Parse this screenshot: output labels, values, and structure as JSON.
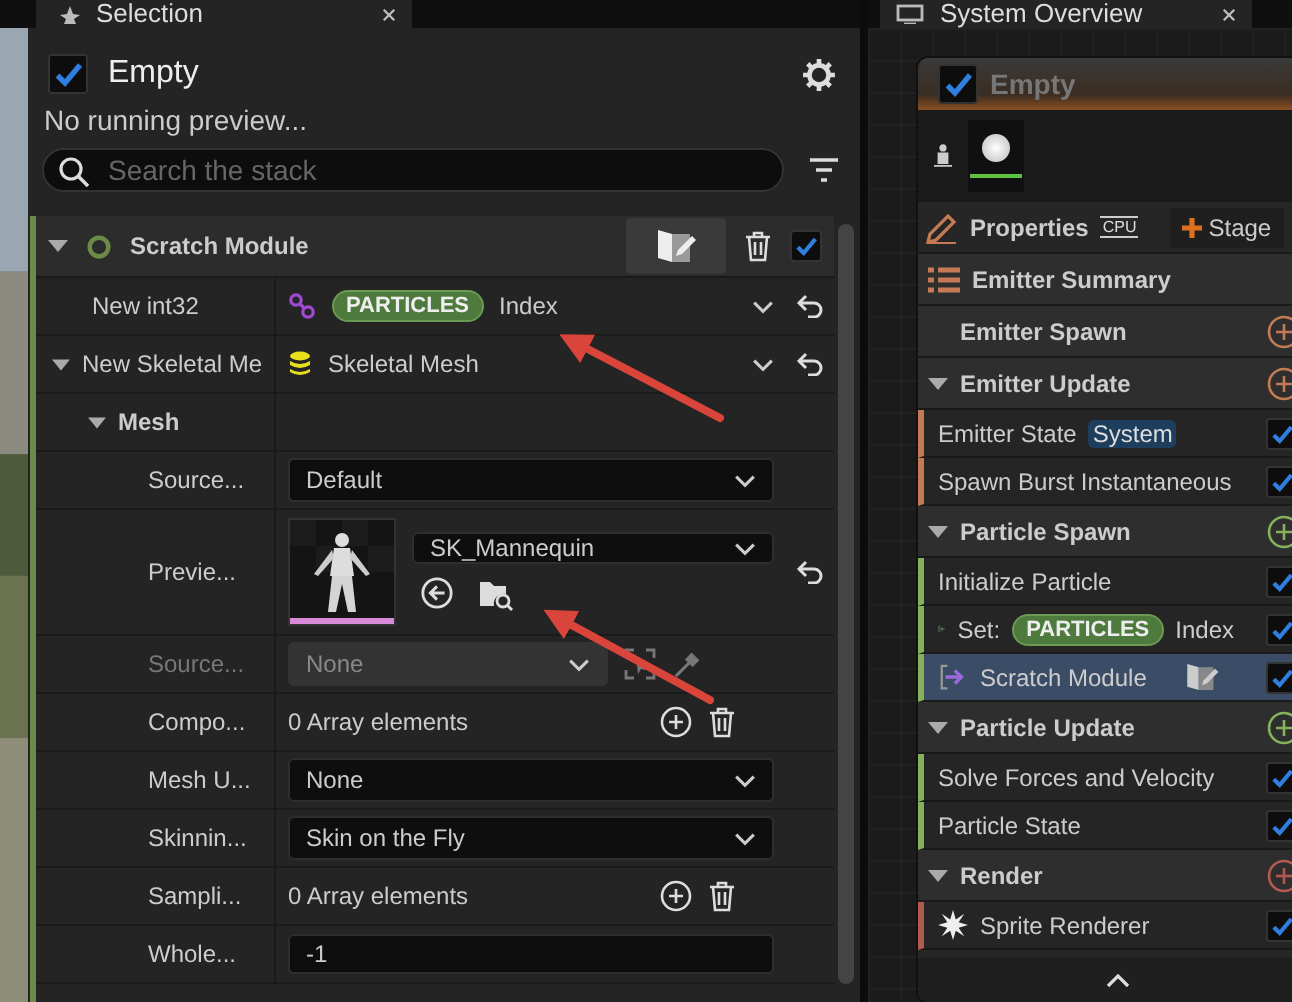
{
  "selection_panel": {
    "tab": "Selection",
    "emitter": {
      "name": "Empty",
      "enabled": true
    },
    "status": "No running preview...",
    "search": {
      "placeholder": "Search the stack"
    },
    "module": {
      "name": "Scratch Module",
      "enabled": true,
      "expanded": true
    },
    "rows": [
      {
        "kind": "binding",
        "label": "New int32",
        "namespace": "PARTICLES",
        "value": "Index",
        "modified": true
      },
      {
        "kind": "object",
        "label": "New Skeletal Me",
        "value": "Skeletal Mesh",
        "modified": true,
        "expanded": true,
        "children": [
          {
            "kind": "category",
            "label": "Mesh",
            "expanded": true,
            "children": [
              {
                "kind": "dropdown",
                "label": "Source...",
                "value": "Default",
                "disabled": false,
                "modified": false
              },
              {
                "kind": "asset",
                "label": "Previe...",
                "value": "SK_Mannequin",
                "modified": true
              },
              {
                "kind": "actor",
                "label": "Source...",
                "value": "None",
                "disabled": true,
                "modified": false
              },
              {
                "kind": "array",
                "label": "Compo...",
                "value": "0 Array elements",
                "modified": false
              },
              {
                "kind": "dropdown",
                "label": "Mesh U...",
                "value": "None",
                "disabled": false,
                "modified": false
              },
              {
                "kind": "dropdown",
                "label": "Skinnin...",
                "value": "Skin on the Fly",
                "disabled": false,
                "modified": false
              },
              {
                "kind": "array",
                "label": "Sampli...",
                "value": "0 Array elements",
                "modified": false
              },
              {
                "kind": "number",
                "label": "Whole...",
                "value": "-1",
                "modified": false
              }
            ]
          }
        ]
      }
    ]
  },
  "overview_panel": {
    "tab": "System Overview",
    "emitter": {
      "name": "Empty",
      "enabled": true
    },
    "properties": "Properties",
    "sim_target": "CPU",
    "add_stage": "Stage",
    "sections": [
      {
        "kind": "summary",
        "label": "Emitter Summary"
      },
      {
        "kind": "stage",
        "label": "Emitter Spawn",
        "color": "#c47a55"
      },
      {
        "kind": "stage",
        "label": "Emitter Update",
        "color": "#c47a55",
        "expanded": true,
        "modules": [
          {
            "kind": "module",
            "label": "Emitter State",
            "tag": "System",
            "enabled": true,
            "selected": false
          },
          {
            "kind": "module",
            "label": "Spawn Burst Instantaneous",
            "enabled": true,
            "selected": false
          }
        ]
      },
      {
        "kind": "stage",
        "label": "Particle Spawn",
        "color": "#86b05a",
        "expanded": true,
        "modules": [
          {
            "kind": "module",
            "label": "Initialize Particle",
            "enabled": true,
            "selected": false
          },
          {
            "kind": "set",
            "label": "Set:",
            "namespace": "PARTICLES",
            "value": "Index",
            "enabled": true,
            "selected": false
          },
          {
            "kind": "scratch",
            "label": "Scratch Module",
            "enabled": true,
            "selected": true
          }
        ]
      },
      {
        "kind": "stage",
        "label": "Particle Update",
        "color": "#86b05a",
        "expanded": true,
        "modules": [
          {
            "kind": "module",
            "label": "Solve Forces and Velocity",
            "enabled": true,
            "selected": false
          },
          {
            "kind": "module",
            "label": "Particle State",
            "enabled": true,
            "selected": false
          }
        ]
      },
      {
        "kind": "stage",
        "label": "Render",
        "color": "#b35a50",
        "expanded": true,
        "modules": [
          {
            "kind": "renderer",
            "label": "Sprite Renderer",
            "enabled": true,
            "selected": false
          }
        ]
      }
    ]
  }
}
